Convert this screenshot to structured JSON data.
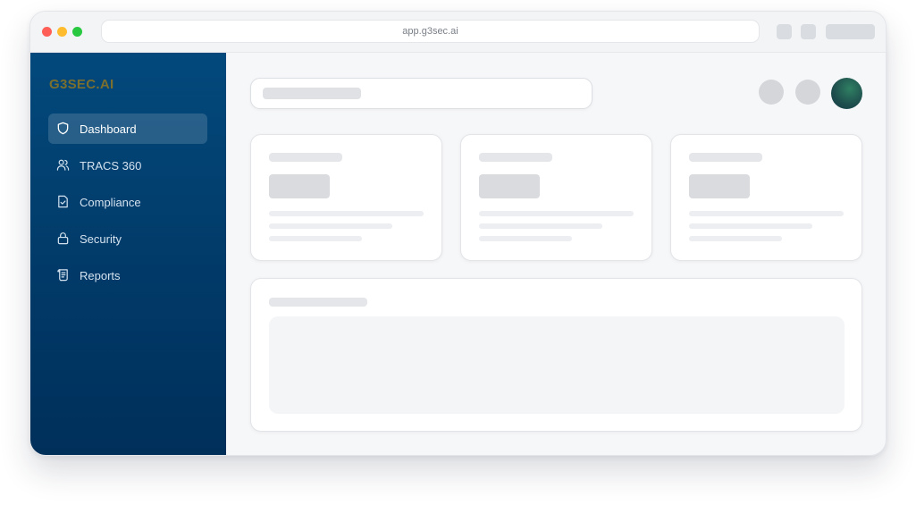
{
  "browser": {
    "url": "app.g3sec.ai"
  },
  "sidebar": {
    "logo": "G3SEC.AI",
    "items": [
      {
        "label": "Dashboard",
        "icon": "shield-icon",
        "active": true
      },
      {
        "label": "TRACS 360",
        "icon": "users-icon",
        "active": false
      },
      {
        "label": "Compliance",
        "icon": "document-check-icon",
        "active": false
      },
      {
        "label": "Security",
        "icon": "lock-icon",
        "active": false
      },
      {
        "label": "Reports",
        "icon": "scroll-icon",
        "active": false
      }
    ]
  },
  "colors": {
    "sidebar_top": "#03497c",
    "sidebar_bottom": "#002f5a",
    "logo": "#7a6f2f",
    "avatar": "#1e4d4d"
  }
}
